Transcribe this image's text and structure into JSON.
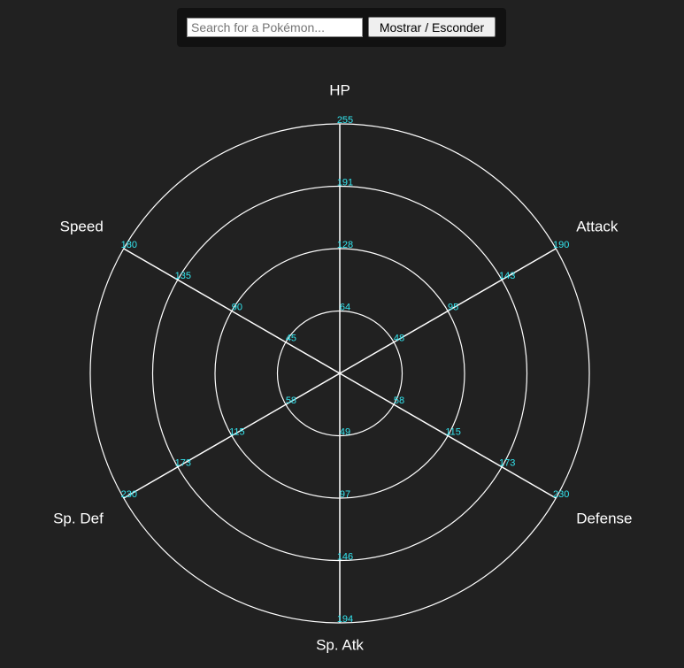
{
  "controls": {
    "search_placeholder": "Search for a Pokémon...",
    "toggle_label": "Mostrar / Esconder"
  },
  "chart_data": {
    "type": "radar",
    "axes": [
      "HP",
      "Attack",
      "Defense",
      "Sp. Atk",
      "Sp. Def",
      "Speed"
    ],
    "axis_max": [
      255,
      190,
      230,
      194,
      230,
      180
    ],
    "rings": 4,
    "tick_labels": [
      [
        "64",
        "128",
        "191",
        "255"
      ],
      [
        "48",
        "95",
        "143",
        "190"
      ],
      [
        "58",
        "115",
        "173",
        "230"
      ],
      [
        "49",
        "97",
        "146",
        "194"
      ],
      [
        "58",
        "115",
        "173",
        "230"
      ],
      [
        "45",
        "90",
        "135",
        "180"
      ]
    ],
    "series": [],
    "colors": {
      "background": "#212121",
      "grid": "#ffffff",
      "tick_text": "#33e6f0",
      "axis_text": "#ffffff"
    }
  }
}
